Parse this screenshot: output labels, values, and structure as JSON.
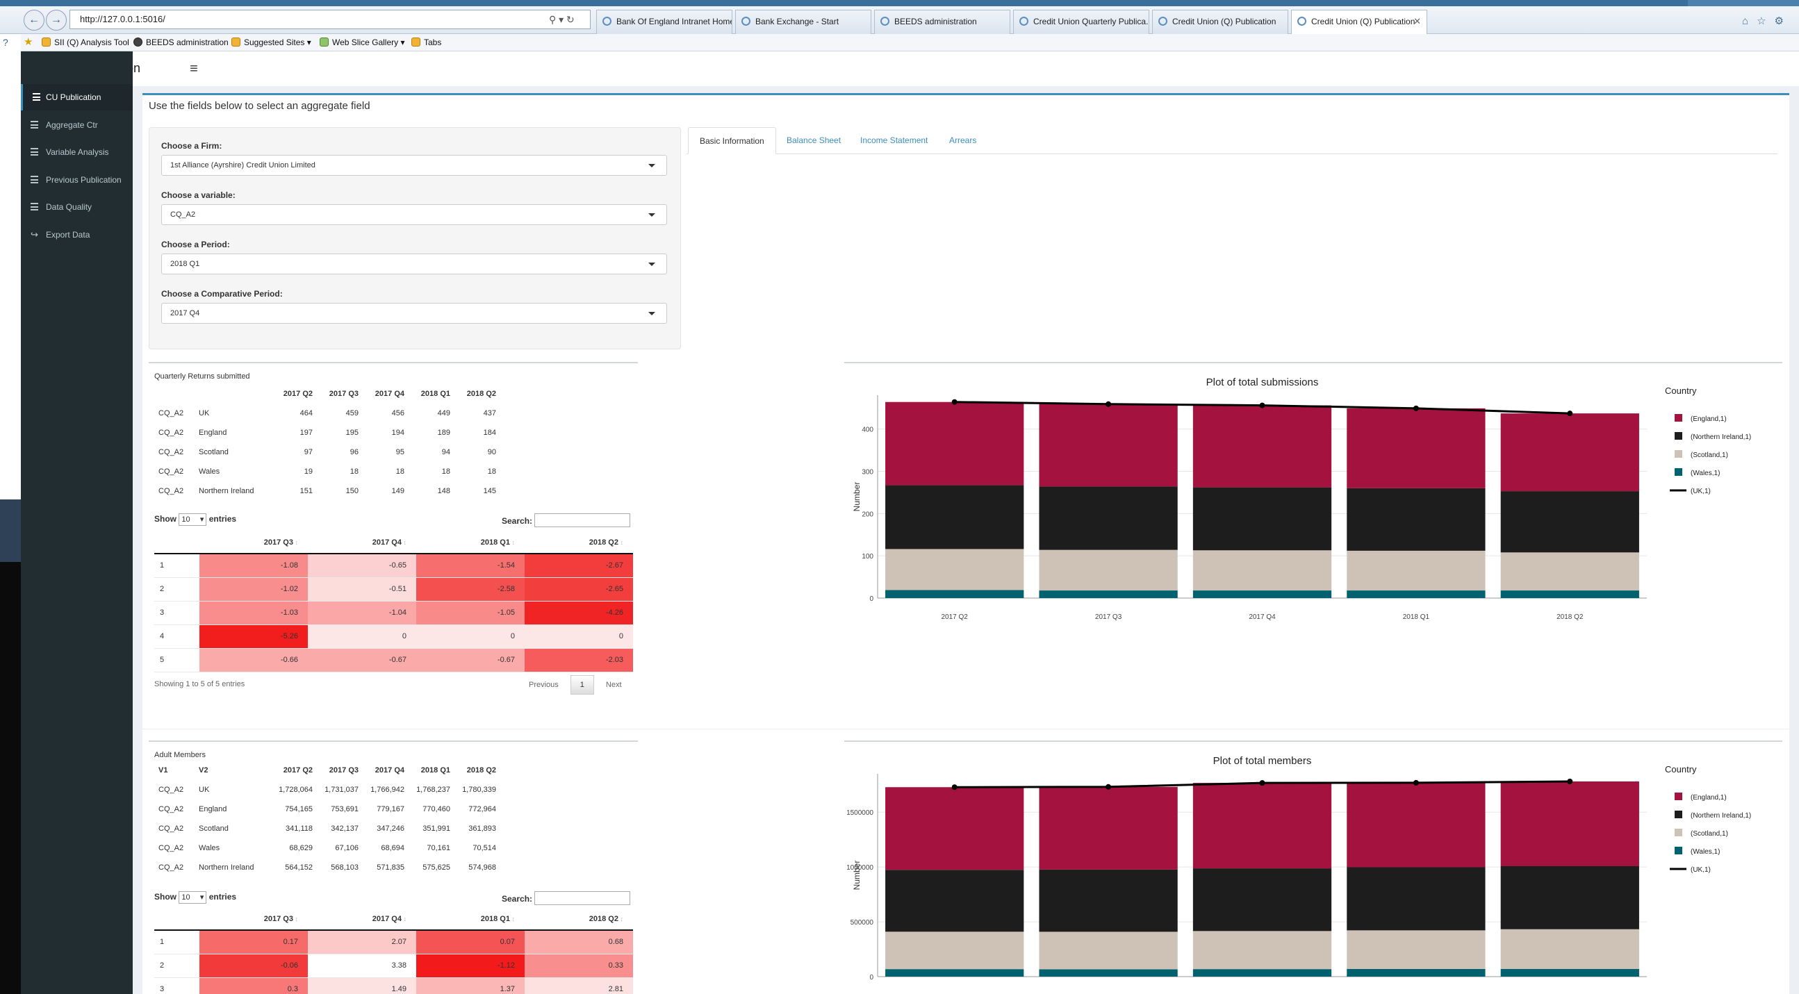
{
  "browser": {
    "url": "http://127.0.0.1:5016/",
    "tabs": [
      {
        "label": "Bank Of England Intranet Home",
        "active": false
      },
      {
        "label": "Bank Exchange - Start",
        "active": false
      },
      {
        "label": "BEEDS administration",
        "active": false
      },
      {
        "label": "Credit Union Quarterly Publica...",
        "active": false
      },
      {
        "label": "Credit Union (Q) Publication",
        "active": false
      },
      {
        "label": "Credit Union (Q) Publication",
        "active": true
      }
    ],
    "favorites": [
      "SII (Q) Analysis Tool",
      "BEEDS administration",
      "Suggested Sites ▾",
      "Web Slice Gallery ▾",
      "Tabs"
    ]
  },
  "app": {
    "brand": "CQ Publication",
    "menu_icon": "≡",
    "sidebar": [
      {
        "label": "CU Publication",
        "icon": "list-icon",
        "active": true
      },
      {
        "label": "Aggregate Ctr",
        "icon": "list-icon",
        "active": false
      },
      {
        "label": "Variable Analysis",
        "icon": "list-icon",
        "active": false
      },
      {
        "label": "Previous Publication",
        "icon": "list-icon",
        "active": false
      },
      {
        "label": "Data Quality",
        "icon": "list-icon",
        "active": false
      },
      {
        "label": "Export Data",
        "icon": "share-icon",
        "active": false
      }
    ]
  },
  "main": {
    "hint": "Use the fields below to select an aggregate field",
    "form": [
      {
        "label": "Choose a Firm:",
        "value": "1st Alliance (Ayrshire) Credit Union Limited"
      },
      {
        "label": "Choose a variable:",
        "value": "CQ_A2"
      },
      {
        "label": "Choose a Period:",
        "value": "2018 Q1"
      },
      {
        "label": "Choose a Comparative Period:",
        "value": "2017 Q4"
      }
    ],
    "tabs": [
      "Basic Information",
      "Balance Sheet",
      "Income Statement",
      "Arrears"
    ],
    "active_tab": "Basic Information"
  },
  "section1": {
    "caption": "Quarterly Returns submitted",
    "headers": [
      "",
      "",
      "2017 Q2",
      "2017 Q3",
      "2017 Q4",
      "2018 Q1",
      "2018 Q2"
    ],
    "rows": [
      [
        "CQ_A2",
        "UK",
        "464",
        "459",
        "456",
        "449",
        "437"
      ],
      [
        "CQ_A2",
        "England",
        "197",
        "195",
        "194",
        "189",
        "184"
      ],
      [
        "CQ_A2",
        "Scotland",
        "97",
        "96",
        "95",
        "94",
        "90"
      ],
      [
        "CQ_A2",
        "Wales",
        "19",
        "18",
        "18",
        "18",
        "18"
      ],
      [
        "CQ_A2",
        "Northern Ireland",
        "151",
        "150",
        "149",
        "148",
        "145"
      ]
    ],
    "show_label": "Show",
    "show_value": "10",
    "entries_label": "entries",
    "search_label": "Search:",
    "dt_headers": [
      "",
      "2017 Q3",
      "2017 Q4",
      "2018 Q1",
      "2018 Q2"
    ],
    "dt_rows": [
      [
        "1",
        "-1.08",
        "-0.65",
        "-1.54",
        "-2.67"
      ],
      [
        "2",
        "-1.02",
        "-0.51",
        "-2.58",
        "-2.65"
      ],
      [
        "3",
        "-1.03",
        "-1.04",
        "-1.05",
        "-4.26"
      ],
      [
        "4",
        "-5.26",
        "0",
        "0",
        "0"
      ],
      [
        "5",
        "-0.66",
        "-0.67",
        "-0.67",
        "-2.03"
      ]
    ],
    "dt_colors": [
      [
        "#f98a8a",
        "#fcd0d0",
        "#f76e6e",
        "#f33c3c"
      ],
      [
        "#f98e8e",
        "#fddcdc",
        "#f45050",
        "#f33e3e"
      ],
      [
        "#f98d8d",
        "#fba7a7",
        "#f88a8a",
        "#f02424"
      ],
      [
        "#f21d1d",
        "#fde6e6",
        "#fde6e6",
        "#fde6e6"
      ],
      [
        "#fbaaaa",
        "#fbaaaa",
        "#fbaaaa",
        "#f65c5c"
      ]
    ],
    "info": "Showing 1 to 5 of 5 entries",
    "prev": "Previous",
    "page": "1",
    "next": "Next"
  },
  "section2": {
    "caption": "Adult Members",
    "headers": [
      "V1",
      "V2",
      "2017 Q2",
      "2017 Q3",
      "2017 Q4",
      "2018 Q1",
      "2018 Q2"
    ],
    "rows": [
      [
        "CQ_A2",
        "UK",
        "1,728,064",
        "1,731,037",
        "1,766,942",
        "1,768,237",
        "1,780,339"
      ],
      [
        "CQ_A2",
        "England",
        "754,165",
        "753,691",
        "779,167",
        "770,460",
        "772,964"
      ],
      [
        "CQ_A2",
        "Scotland",
        "341,118",
        "342,137",
        "347,246",
        "351,991",
        "361,893"
      ],
      [
        "CQ_A2",
        "Wales",
        "68,629",
        "67,106",
        "68,694",
        "70,161",
        "70,514"
      ],
      [
        "CQ_A2",
        "Northern Ireland",
        "564,152",
        "568,103",
        "571,835",
        "575,625",
        "574,968"
      ]
    ],
    "show_label": "Show",
    "show_value": "10",
    "entries_label": "entries",
    "search_label": "Search:",
    "dt_headers": [
      "",
      "2017 Q3",
      "2017 Q4",
      "2018 Q1",
      "2018 Q2"
    ],
    "dt_rows": [
      [
        "1",
        "0.17",
        "2.07",
        "0.07",
        "0.68"
      ],
      [
        "2",
        "-0.06",
        "3.38",
        "-1.12",
        "0.33"
      ],
      [
        "3",
        "0.3",
        "1.49",
        "1.37",
        "2.81"
      ]
    ],
    "dt_colors": [
      [
        "#f76a6a",
        "#fcc8c8",
        "#f45454",
        "#fbaaaa"
      ],
      [
        "#f33a3a",
        "#ffffff",
        "#f21a1a",
        "#f98e8e"
      ],
      [
        "#f87878",
        "#fde2e2",
        "#fbb6b6",
        "#fde0e0"
      ]
    ]
  },
  "chart_data": [
    {
      "type": "bar",
      "title": "Plot of total submissions",
      "xlabel": "",
      "ylabel": "Number",
      "ylim": [
        0,
        480
      ],
      "yticks": [
        0,
        100,
        200,
        300,
        400
      ],
      "categories": [
        "2017 Q2",
        "2017 Q3",
        "2017 Q4",
        "2018 Q1",
        "2018 Q2"
      ],
      "stacked": true,
      "series": [
        {
          "name": "(Wales,1)",
          "color": "#00626e",
          "values": [
            19,
            18,
            18,
            18,
            18
          ]
        },
        {
          "name": "(Scotland,1)",
          "color": "#cdc2b5",
          "values": [
            97,
            96,
            95,
            94,
            90
          ]
        },
        {
          "name": "(Northern Ireland,1)",
          "color": "#1d1d1d",
          "values": [
            151,
            150,
            149,
            148,
            145
          ]
        },
        {
          "name": "(England,1)",
          "color": "#a4123f",
          "values": [
            197,
            195,
            194,
            189,
            184
          ]
        }
      ],
      "line": {
        "name": "(UK,1)",
        "color": "#000000",
        "values": [
          464,
          459,
          456,
          449,
          437
        ]
      },
      "legend_title": "Country",
      "legend_order": [
        "(England,1)",
        "(Northern Ireland,1)",
        "(Scotland,1)",
        "(Wales,1)",
        "(UK,1)"
      ],
      "legend_position": "right",
      "grid": true
    },
    {
      "type": "bar",
      "title": "Plot of total members",
      "xlabel": "",
      "ylabel": "Number",
      "ylim": [
        0,
        1850000
      ],
      "yticks": [
        0,
        500000,
        1000000,
        1500000
      ],
      "categories": [
        "2017 Q2",
        "2017 Q3",
        "2017 Q4",
        "2018 Q1",
        "2018 Q2"
      ],
      "stacked": true,
      "series": [
        {
          "name": "(Wales,1)",
          "color": "#00626e",
          "values": [
            68629,
            67106,
            68694,
            70161,
            70514
          ]
        },
        {
          "name": "(Scotland,1)",
          "color": "#cdc2b5",
          "values": [
            341118,
            342137,
            347246,
            351991,
            361893
          ]
        },
        {
          "name": "(Northern Ireland,1)",
          "color": "#1d1d1d",
          "values": [
            564152,
            568103,
            571835,
            575625,
            574968
          ]
        },
        {
          "name": "(England,1)",
          "color": "#a4123f",
          "values": [
            754165,
            753691,
            779167,
            770460,
            772964
          ]
        }
      ],
      "line": {
        "name": "(UK,1)",
        "color": "#000000",
        "values": [
          1728064,
          1731037,
          1766942,
          1768237,
          1780339
        ]
      },
      "legend_title": "Country",
      "legend_order": [
        "(England,1)",
        "(Northern Ireland,1)",
        "(Scotland,1)",
        "(Wales,1)",
        "(UK,1)"
      ],
      "legend_position": "right",
      "grid": true
    }
  ]
}
